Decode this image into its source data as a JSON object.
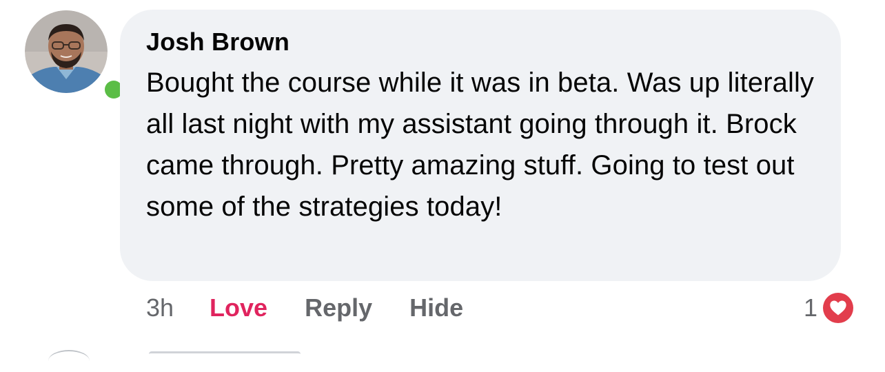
{
  "colors": {
    "bubble_bg": "#f0f2f5",
    "love_color": "#e0245e",
    "meta_grey": "#65676b",
    "online_green": "#5bbd46",
    "heart_badge": "#e23d4c"
  },
  "comment": {
    "author": "Josh Brown",
    "text": "Bought the course while it was in beta. Was up literally all last night with my assistant going through it. Brock came through. Pretty amazing stuff. Going to test out some of the strategies today!",
    "timestamp": "3h",
    "online": true,
    "avatar_icon": "profile-photo",
    "actions": {
      "love_label": "Love",
      "reply_label": "Reply",
      "hide_label": "Hide"
    },
    "reactions": {
      "count": "1",
      "icon": "heart-icon"
    }
  }
}
